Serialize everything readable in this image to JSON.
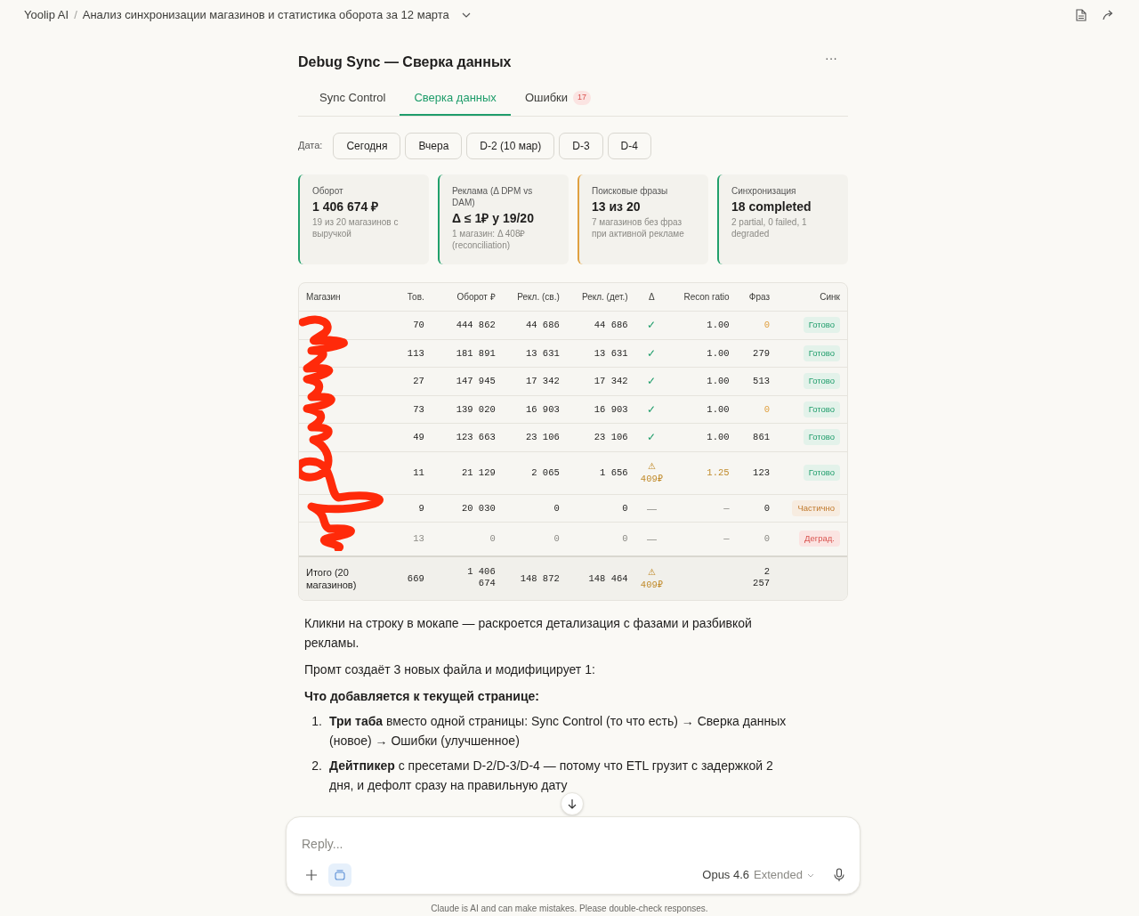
{
  "header": {
    "brand": "Yoolip AI",
    "separator": "/",
    "chat_title": "Анализ синхронизации магазинов и статистика оборота за 12 марта"
  },
  "artifact": {
    "title": "Debug Sync — Сверка данных",
    "menu": "···",
    "tabs": [
      {
        "label": "Sync Control",
        "selected": false
      },
      {
        "label": "Сверка данных",
        "selected": true
      },
      {
        "label": "Ошибки",
        "badge": "17",
        "selected": false
      }
    ],
    "date_label": "Дата:",
    "dates": [
      {
        "label": "Сегодня",
        "selected": false
      },
      {
        "label": "Вчера",
        "selected": false
      },
      {
        "label": "D-2 (10 мар)",
        "selected": false
      },
      {
        "label": "D-3",
        "selected": false
      },
      {
        "label": "D-4",
        "selected": false
      }
    ],
    "cards": [
      {
        "title": "Оборот",
        "value": "1 406 674 ₽",
        "note": "19 из 20 магазинов с выручкой",
        "color": "#22a06b"
      },
      {
        "title": "Реклама (Δ DPM vs DAM)",
        "value": "Δ ≤ 1₽ у 19/20",
        "note": "1 магазин: Δ 408₽ (reconciliation)",
        "color": "#22a06b"
      },
      {
        "title": "Поисковые фразы",
        "value": "13 из 20",
        "note": "7 магазинов без фраз при активной рекламе",
        "color": "#e0a040"
      },
      {
        "title": "Синхронизация",
        "value": "18 completed",
        "note": "2 partial, 0 failed, 1 degraded",
        "color": "#22a06b"
      }
    ],
    "table": {
      "columns": [
        "Магазин",
        "Тов.",
        "Оборот ₽",
        "Рекл. (св.)",
        "Рекл. (дет.)",
        "Δ",
        "Recon ratio",
        "Фраз",
        "Синк"
      ],
      "names_redacted": true,
      "rows": [
        {
          "goods": "70",
          "turnover": "444 862",
          "ads_sum": "44 686",
          "ads_det": "44 686",
          "delta": {
            "kind": "ok",
            "text": "✓"
          },
          "ratio": {
            "text": "1.00",
            "warn": false
          },
          "phrases": {
            "text": "0",
            "zero": true
          },
          "sync": {
            "label": "Готово",
            "kind": "done"
          },
          "muted": false
        },
        {
          "goods": "113",
          "turnover": "181 891",
          "ads_sum": "13 631",
          "ads_det": "13 631",
          "delta": {
            "kind": "ok",
            "text": "✓"
          },
          "ratio": {
            "text": "1.00",
            "warn": false
          },
          "phrases": {
            "text": "279",
            "zero": false
          },
          "sync": {
            "label": "Готово",
            "kind": "done"
          },
          "muted": false
        },
        {
          "goods": "27",
          "turnover": "147 945",
          "ads_sum": "17 342",
          "ads_det": "17 342",
          "delta": {
            "kind": "ok",
            "text": "✓"
          },
          "ratio": {
            "text": "1.00",
            "warn": false
          },
          "phrases": {
            "text": "513",
            "zero": false
          },
          "sync": {
            "label": "Готово",
            "kind": "done"
          },
          "muted": false
        },
        {
          "goods": "73",
          "turnover": "139 020",
          "ads_sum": "16 903",
          "ads_det": "16 903",
          "delta": {
            "kind": "ok",
            "text": "✓"
          },
          "ratio": {
            "text": "1.00",
            "warn": false
          },
          "phrases": {
            "text": "0",
            "zero": true
          },
          "sync": {
            "label": "Готово",
            "kind": "done"
          },
          "muted": false
        },
        {
          "goods": "49",
          "turnover": "123 663",
          "ads_sum": "23 106",
          "ads_det": "23 106",
          "delta": {
            "kind": "ok",
            "text": "✓"
          },
          "ratio": {
            "text": "1.00",
            "warn": false
          },
          "phrases": {
            "text": "861",
            "zero": false
          },
          "sync": {
            "label": "Готово",
            "kind": "done"
          },
          "muted": false
        },
        {
          "goods": "11",
          "turnover": "21 129",
          "ads_sum": "2 065",
          "ads_det": "1 656",
          "delta": {
            "kind": "warn",
            "icon": "⚠",
            "text": "409₽"
          },
          "ratio": {
            "text": "1.25",
            "warn": true
          },
          "phrases": {
            "text": "123",
            "zero": false
          },
          "sync": {
            "label": "Готово",
            "kind": "done"
          },
          "muted": false
        },
        {
          "goods": "9",
          "turnover": "20 030",
          "ads_sum": "0",
          "ads_det": "0",
          "delta": {
            "kind": "none",
            "text": "—"
          },
          "ratio": {
            "text": "—",
            "warn": false
          },
          "phrases": {
            "text": "0",
            "zero": false
          },
          "sync": {
            "label": "Частично",
            "kind": "partial"
          },
          "muted": false
        },
        {
          "goods": "13",
          "turnover": "0",
          "ads_sum": "0",
          "ads_det": "0",
          "delta": {
            "kind": "none",
            "text": "—"
          },
          "ratio": {
            "text": "—",
            "warn": false
          },
          "phrases": {
            "text": "0",
            "zero": false
          },
          "sync": {
            "label": "Деград.",
            "kind": "degraded"
          },
          "muted": true
        }
      ],
      "total": {
        "label": "Итого (20 магазинов)",
        "goods": "669",
        "turnover": "1 406 674",
        "ads_sum": "148 872",
        "ads_det": "148 464",
        "delta": {
          "kind": "warn",
          "icon": "⚠",
          "text": "409₽"
        },
        "phrases": "2 257"
      }
    }
  },
  "message": {
    "paragraphs": [
      "Кликни на строку в мокапе — раскроется детализация с фазами и разбивкой рекламы.",
      "Промт создаёт 3 новых файла и модифицирует 1:"
    ],
    "heading": "Что добавляется к текущей странице:",
    "list": [
      {
        "number": "1.",
        "text": "**Три таба** вместо одной страницы: Sync Control (то что есть) → Сверка данных (новое) → Ошибки (улучшенное)"
      },
      {
        "number": "2.",
        "text": "**Дейтпикер** с пресетами D-2/D-3/D-4 — потому что ETL грузит с задержкой 2 дня, и дефолт сразу на правильную дату"
      }
    ]
  },
  "composer": {
    "placeholder": "Reply...",
    "model": "Opus 4.6",
    "mode": "Extended"
  },
  "disclaimer": "Claude is AI and can make mistakes. Please double-check responses."
}
